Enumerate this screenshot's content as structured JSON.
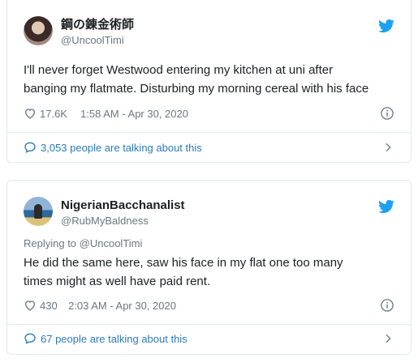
{
  "tweets": [
    {
      "display_name": "鋼の錬金術師",
      "handle": "@UncoolTimi",
      "reply_to": "",
      "text_lines": [
        "I'll never forget Westwood entering my kitchen at uni after",
        "banging my flatmate. Disturbing my morning cereal with his face"
      ],
      "likes": "17.6K",
      "time": "1:58 AM - Apr 30, 2020",
      "talking": "3,053 people are talking about this"
    },
    {
      "display_name": "NigerianBacchanalist",
      "handle": "@RubMyBaldness",
      "reply_to": "Replying to @UncoolTimi",
      "text_lines": [
        "He did the same here, saw his face in my flat one too many",
        "times might as well have paid rent."
      ],
      "likes": "430",
      "time": "2:03 AM - Apr 30, 2020",
      "talking": "67 people are talking about this"
    }
  ],
  "colors": {
    "twitter_blue": "#1da1f2",
    "link_blue": "#2b7bb9",
    "muted": "#697882",
    "border": "#e1e8ed"
  },
  "icons": [
    "twitter-bird-icon",
    "heart-icon",
    "info-icon",
    "speech-bubble-icon",
    "chevron-right-icon"
  ]
}
